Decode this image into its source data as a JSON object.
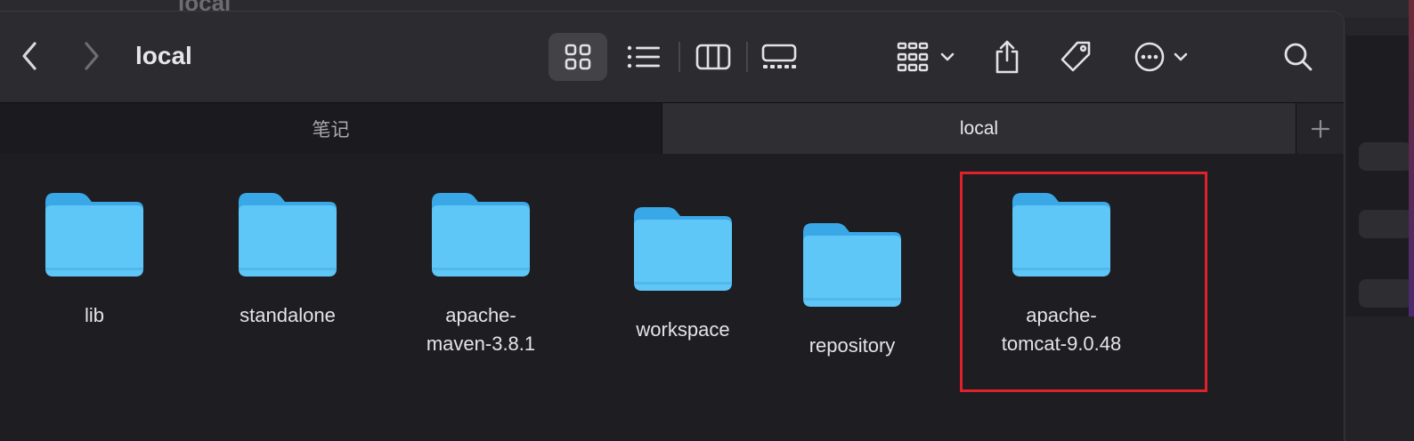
{
  "background_window": {
    "title": "local"
  },
  "window": {
    "title": "local",
    "nav": {
      "back_icon": "chevron-left-icon",
      "forward_icon": "chevron-right-icon"
    },
    "toolbar": {
      "icons": [
        "icon-view-icon",
        "list-view-icon",
        "column-view-icon",
        "gallery-view-icon",
        "group-icon",
        "share-icon",
        "tag-icon",
        "more-icon",
        "search-icon"
      ]
    },
    "tabs": [
      {
        "label": "笔记",
        "active": false
      },
      {
        "label": "local",
        "active": true
      }
    ],
    "new_tab_icon": "plus-icon"
  },
  "folders": [
    {
      "name": "lib"
    },
    {
      "name": "standalone"
    },
    {
      "name": "apache-\nmaven-3.8.1"
    },
    {
      "name": "workspace"
    },
    {
      "name": "repository"
    },
    {
      "name": "apache-\ntomcat-9.0.48"
    }
  ],
  "colors": {
    "folder_light": "#5ec7f8",
    "folder_dark": "#3aa8e6",
    "highlight": "#e0202a"
  }
}
